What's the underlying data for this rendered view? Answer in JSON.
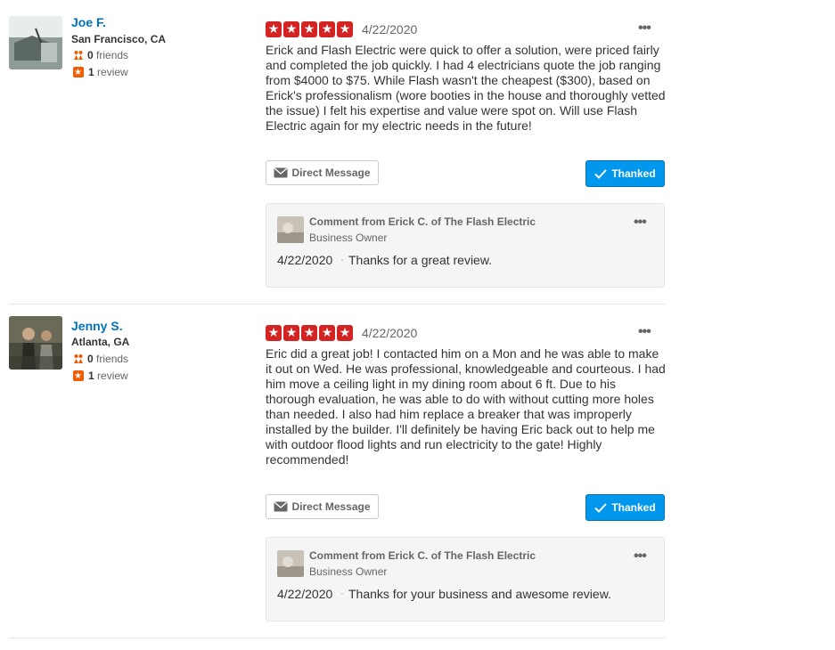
{
  "reviews": [
    {
      "user": {
        "name": "Joe F.",
        "location": "San Francisco, CA",
        "friends_count": "0",
        "friends_label": "friends",
        "reviews_count": "1",
        "reviews_label": "review"
      },
      "rating": 5,
      "date": "4/22/2020",
      "text": "Erick and Flash Electric were quick to offer a solution, were priced fairly and completed the job quickly. I had 4 electricians quote the job ranging from $4000 to $75. While Flash wasn't the cheapest ($300), based on Erick's professionalism (wore booties in the house and thoroughly vetted the issue) I felt his expertise and value were spot on. Will use Flash Electric again for my electric needs in the future!",
      "direct_message_label": "Direct Message",
      "thanked_label": "Thanked",
      "owner_comment": {
        "title": "Comment from Erick C. of The Flash Electric",
        "role": "Business Owner",
        "date": "4/22/2020",
        "text": "Thanks for a great review."
      }
    },
    {
      "user": {
        "name": "Jenny S.",
        "location": "Atlanta, GA",
        "friends_count": "0",
        "friends_label": "friends",
        "reviews_count": "1",
        "reviews_label": "review"
      },
      "rating": 5,
      "date": "4/22/2020",
      "text": "Eric did a great job! I contacted him on a Mon and he was able to make it out on Wed. He was professional, knowledgeable and courteous. I had him move a ceiling light in my dining room about 6 ft. Due to his thorough evaluation, he was able to do with without cutting more holes than needed. I also had him replace a breaker that was improperly installed by the builder. I'll definitely be having Eric back out to help me with outdoor flood lights and run electricity to the gate! Highly recommended!",
      "direct_message_label": "Direct Message",
      "thanked_label": "Thanked",
      "owner_comment": {
        "title": "Comment from Erick C. of The Flash Electric",
        "role": "Business Owner",
        "date": "4/22/2020",
        "text": "Thanks for your business and awesome review."
      }
    }
  ],
  "colors": {
    "link": "#0073bb",
    "star": "#d32323",
    "thanked": "#0097ec"
  }
}
